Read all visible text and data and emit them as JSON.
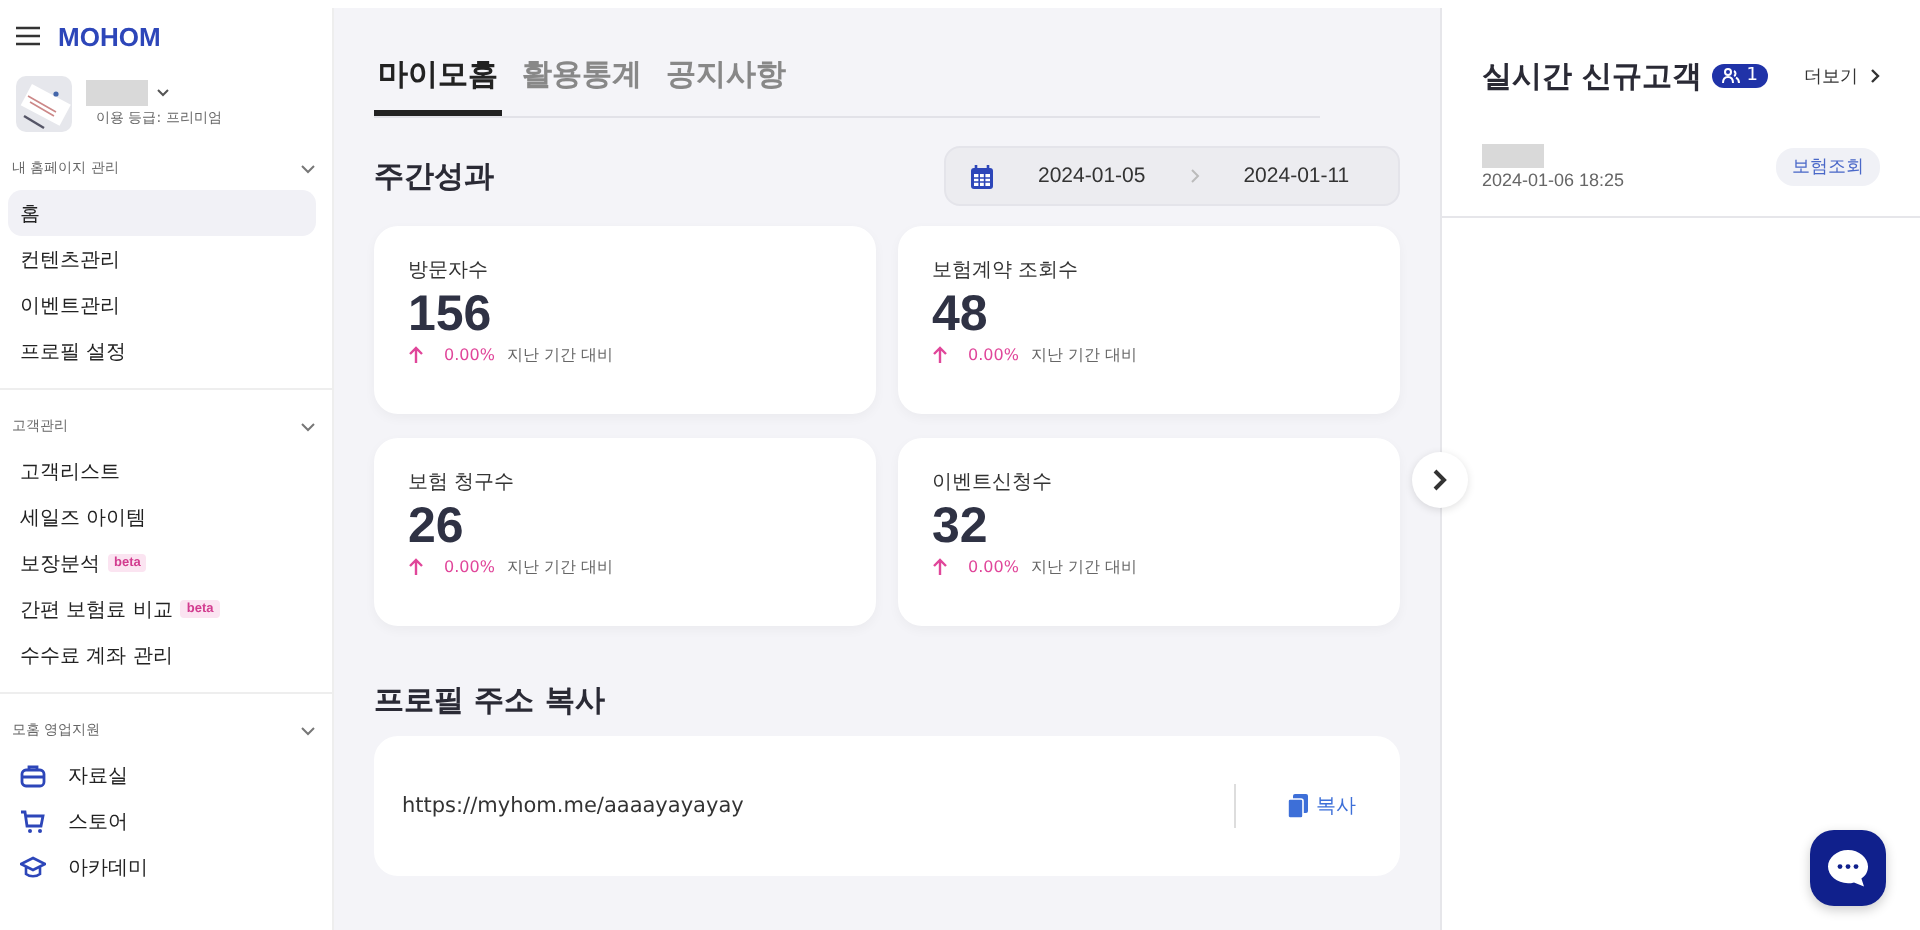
{
  "brand": {
    "logo": "MOHOM"
  },
  "profile": {
    "grade": "이용 등급: 프리미엄"
  },
  "sidebar": {
    "sections": [
      {
        "title": "내 홈페이지 관리",
        "expanded": true,
        "items": [
          {
            "label": "홈",
            "selected": true
          },
          {
            "label": "컨텐츠관리",
            "selected": false
          },
          {
            "label": "이벤트관리",
            "selected": false
          },
          {
            "label": "프로필 설정",
            "selected": false
          }
        ]
      },
      {
        "title": "고객관리",
        "expanded": true,
        "items": [
          {
            "label": "고객리스트",
            "selected": false
          },
          {
            "label": "세일즈 아이템",
            "selected": false
          },
          {
            "label": "보장분석",
            "badge": "beta",
            "selected": false
          },
          {
            "label": "간편 보험료 비교",
            "badge": "beta",
            "selected": false
          },
          {
            "label": "수수료 계좌 관리",
            "selected": false
          }
        ]
      },
      {
        "title": "모홈 영업지원",
        "expanded": true,
        "items": [
          {
            "label": "자료실",
            "kind": "box",
            "selected": false
          },
          {
            "label": "스토어",
            "kind": "cart",
            "selected": false
          },
          {
            "label": "아카데미",
            "kind": "cap",
            "selected": false
          }
        ]
      }
    ]
  },
  "tabs": [
    {
      "label": "마이모홈",
      "selected": true
    },
    {
      "label": "활용통계",
      "selected": false
    },
    {
      "label": "공지사항",
      "selected": false
    }
  ],
  "weekly": {
    "title": "주간성과",
    "date_from": "2024-01-05",
    "date_to": "2024-01-11",
    "cards": [
      {
        "label": "방문자수",
        "value": "156",
        "change": "0.00%",
        "compare": "지난 기간 대비"
      },
      {
        "label": "보험계약 조회수",
        "value": "48",
        "change": "0.00%",
        "compare": "지난 기간 대비"
      },
      {
        "label": "보험 청구수",
        "value": "26",
        "change": "0.00%",
        "compare": "지난 기간 대비"
      },
      {
        "label": "이벤트신청수",
        "value": "32",
        "change": "0.00%",
        "compare": "지난 기간 대비"
      }
    ]
  },
  "profile_link": {
    "title": "프로필 주소 복사",
    "url": "https://myhom.me/aaaayayayay",
    "copy_button": "복사"
  },
  "realtime": {
    "title": "실시간 신규고객",
    "count": "1",
    "more": "더보기",
    "customers": [
      {
        "time": "2024-01-06 18:25",
        "tag": "보험조회"
      }
    ]
  }
}
